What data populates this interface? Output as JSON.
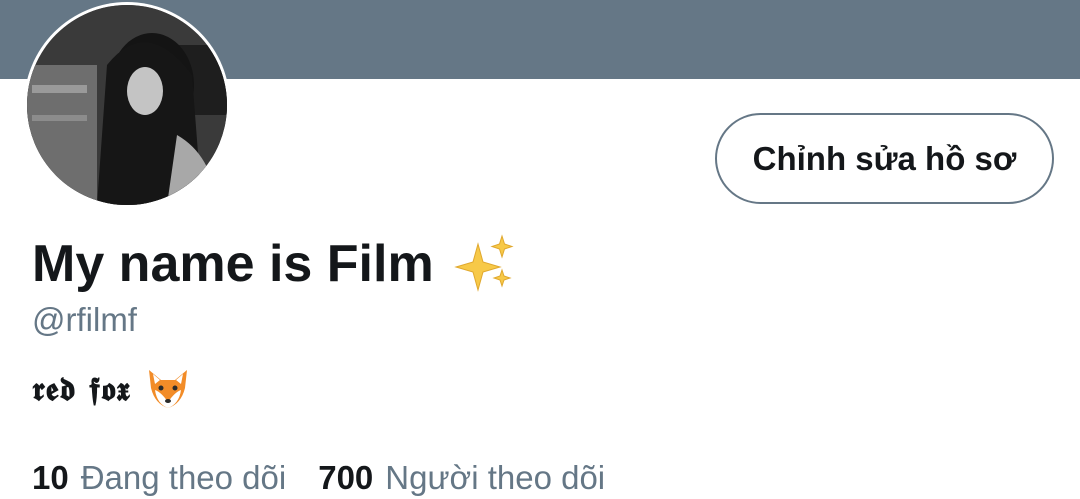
{
  "profile": {
    "display_name": "My name is Film",
    "name_emoji": "sparkles-emoji",
    "handle": "@rfilmf",
    "bio_text": "𝖗𝖊𝖉 𝖋𝖔𝖝",
    "bio_emoji": "fox-emoji"
  },
  "actions": {
    "edit_profile_label": "Chỉnh sửa hồ sơ"
  },
  "stats": {
    "following_count": "10",
    "following_label": "Đang theo dõi",
    "followers_count": "700",
    "followers_label": "Người theo dõi"
  },
  "colors": {
    "banner": "#657786",
    "text_primary": "#14171a",
    "text_secondary": "#657786",
    "background": "#ffffff"
  }
}
